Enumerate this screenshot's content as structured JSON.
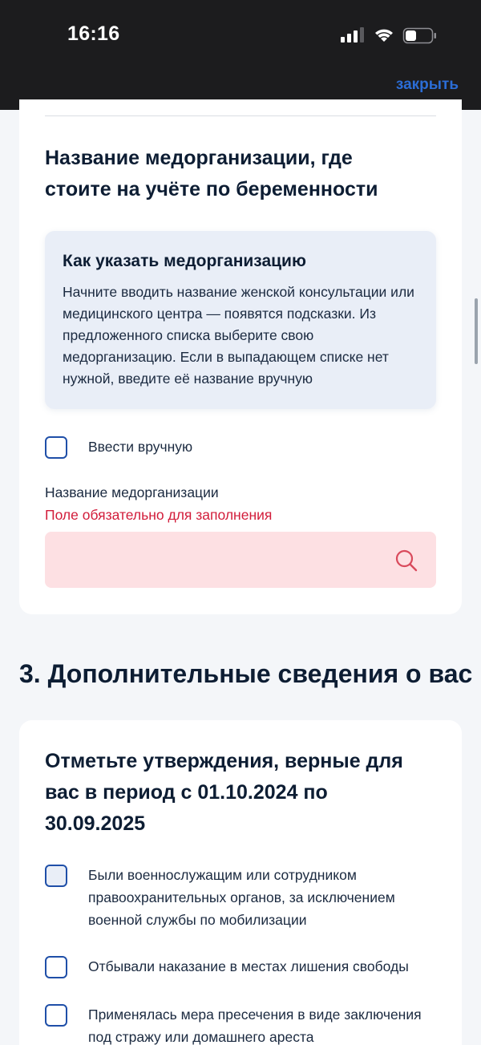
{
  "status_bar": {
    "time": "16:16"
  },
  "header": {
    "close_label": "закрыть"
  },
  "question1": {
    "title": "Название медорганизации, где стоите на учёте по беременности"
  },
  "info_box": {
    "title": "Как указать медорганизацию",
    "text": "Начните вводить название женской консультации или медицинского центра — появятся подсказки. Из предложенного списка выберите свою медорганизацию. Если в выпадающем списке нет нужной, введите её название вручную"
  },
  "manual_checkbox": {
    "label": "Ввести вручную",
    "checked": false
  },
  "org_field": {
    "label": "Название медорганизации",
    "error": "Поле обязательно для заполнения",
    "value": "",
    "placeholder": ""
  },
  "section3": {
    "heading": "3. Дополнительные сведения о вас"
  },
  "question2": {
    "title": "Отметьте утверждения, верные для вас в период с 01.10.2024 по 30.09.2025",
    "options": [
      {
        "label": "Были военнослужащим или сотрудником правоохранительных органов, за исключением военной службы по мобилизации",
        "checked": false
      },
      {
        "label": "Отбывали наказание в местах лишения свободы",
        "checked": false
      },
      {
        "label": "Применялась мера пресечения в виде заключения под стражу или домашнего ареста",
        "checked": false
      }
    ]
  },
  "colors": {
    "accent": "#2b6dd6",
    "checkbox_border": "#1f4fa8",
    "error": "#d21c3a",
    "error_field_bg": "#fde0e3",
    "info_bg": "#e9eef7",
    "header_bg": "#1c1c1e"
  },
  "icons": {
    "signal": "signal-icon",
    "wifi": "wifi-icon",
    "battery": "battery-icon",
    "search": "search-icon"
  }
}
